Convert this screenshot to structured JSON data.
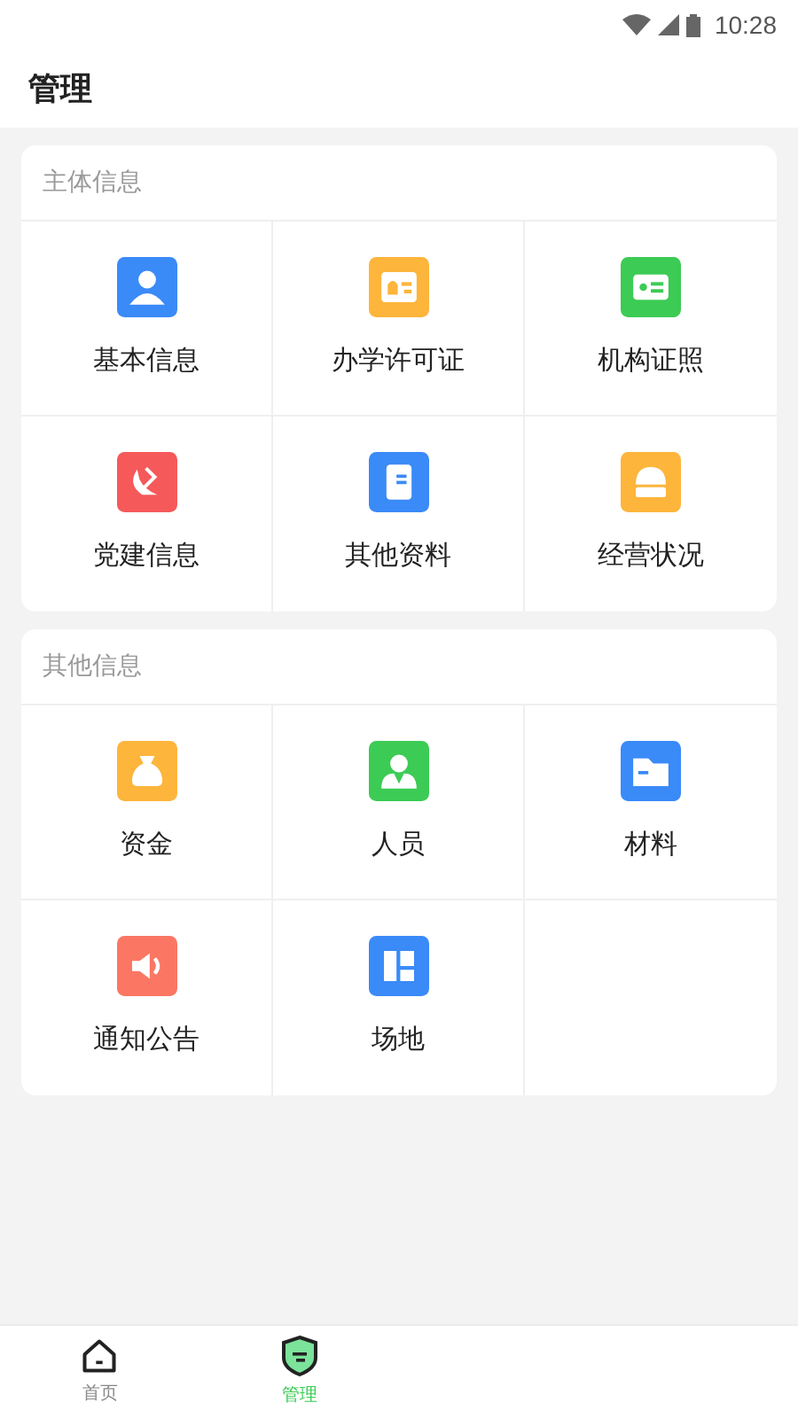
{
  "status_bar": {
    "time": "10:28"
  },
  "header": {
    "title": "管理"
  },
  "sections": [
    {
      "title": "主体信息",
      "items": [
        {
          "label": "基本信息",
          "color": "#3a8af8"
        },
        {
          "label": "办学许可证",
          "color": "#fdb53c"
        },
        {
          "label": "机构证照",
          "color": "#3ccb55"
        },
        {
          "label": "党建信息",
          "color": "#f5595a"
        },
        {
          "label": "其他资料",
          "color": "#3a8af8"
        },
        {
          "label": "经营状况",
          "color": "#fdb53c"
        }
      ]
    },
    {
      "title": "其他信息",
      "items": [
        {
          "label": "资金",
          "color": "#fdb53c"
        },
        {
          "label": "人员",
          "color": "#3ccb55"
        },
        {
          "label": "材料",
          "color": "#3a8af8"
        },
        {
          "label": "通知公告",
          "color": "#fb7764"
        },
        {
          "label": "场地",
          "color": "#3a8af8"
        }
      ]
    }
  ],
  "bottom_nav": [
    {
      "label": "首页",
      "selected": false
    },
    {
      "label": "管理",
      "selected": true
    }
  ]
}
